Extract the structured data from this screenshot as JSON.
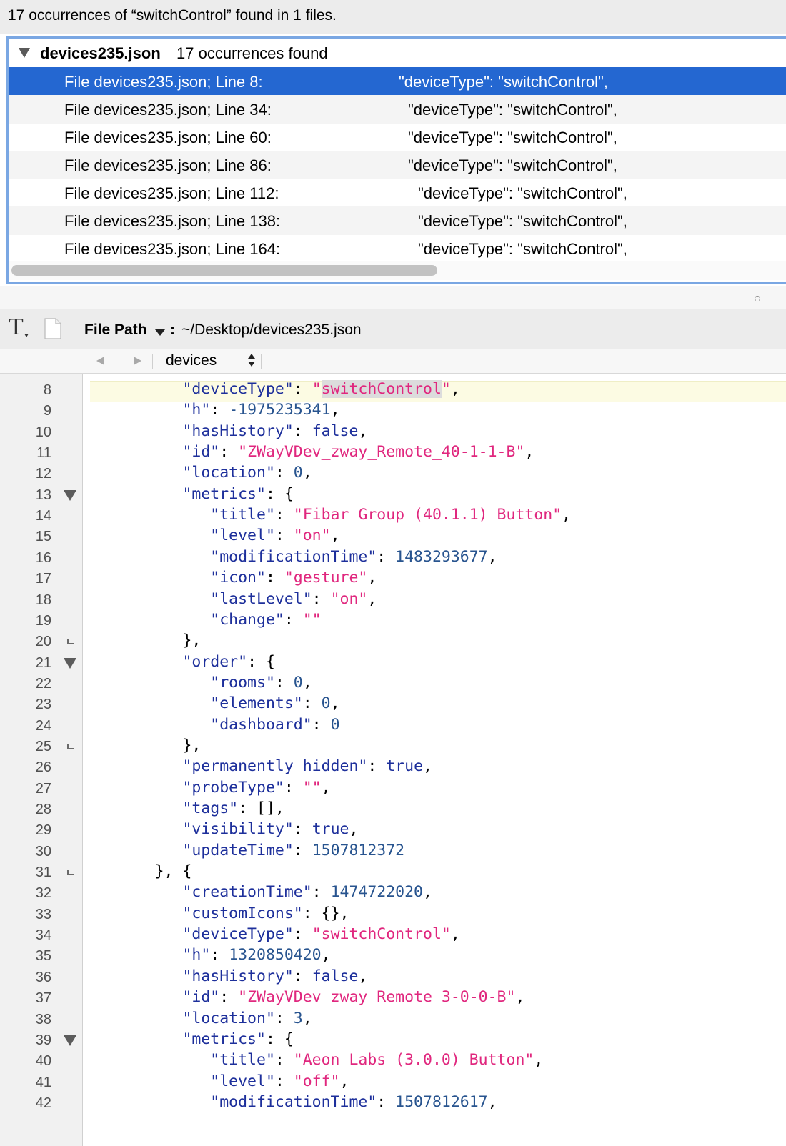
{
  "search": {
    "summary": "17 occurrences of “switchControl” found in 1 files."
  },
  "results": {
    "file": {
      "name": "devices235.json",
      "count": "17 occurrences found"
    },
    "rows": [
      {
        "location": "File devices235.json; Line 8:",
        "match": "\"deviceType\": \"switchControl\",",
        "selected": true
      },
      {
        "location": "File devices235.json; Line 34:",
        "match": "\"deviceType\": \"switchControl\",",
        "selected": false
      },
      {
        "location": "File devices235.json; Line 60:",
        "match": "\"deviceType\": \"switchControl\",",
        "selected": false
      },
      {
        "location": "File devices235.json; Line 86:",
        "match": "\"deviceType\": \"switchControl\",",
        "selected": false
      },
      {
        "location": "File devices235.json; Line 112:",
        "match": "\"deviceType\": \"switchControl\",",
        "selected": false
      },
      {
        "location": "File devices235.json; Line 138:",
        "match": "\"deviceType\": \"switchControl\",",
        "selected": false
      },
      {
        "location": "File devices235.json; Line 164:",
        "match": "\"deviceType\": \"switchControl\",",
        "selected": false
      }
    ]
  },
  "toolbar": {
    "text_icon": "T",
    "path_label": "File Path",
    "path_colon": ":",
    "path_value": "~/Desktop/devices235.json"
  },
  "navbar": {
    "symbol": "devices"
  },
  "editor": {
    "search_term": "switchControl",
    "current_line": 8,
    "lines": [
      {
        "n": 8,
        "fold": "none",
        "tokens": [
          [
            "ws",
            "          "
          ],
          [
            "key",
            "\"deviceType\""
          ],
          [
            "p",
            ": "
          ],
          [
            "str",
            "\"switchControl\"",
            "match"
          ],
          [
            "p",
            ","
          ]
        ]
      },
      {
        "n": 9,
        "fold": "none",
        "tokens": [
          [
            "ws",
            "          "
          ],
          [
            "key",
            "\"h\""
          ],
          [
            "p",
            ": "
          ],
          [
            "num",
            "-1975235341"
          ],
          [
            "p",
            ","
          ]
        ]
      },
      {
        "n": 10,
        "fold": "none",
        "tokens": [
          [
            "ws",
            "          "
          ],
          [
            "key",
            "\"hasHistory\""
          ],
          [
            "p",
            ": "
          ],
          [
            "kw",
            "false"
          ],
          [
            "p",
            ","
          ]
        ]
      },
      {
        "n": 11,
        "fold": "none",
        "tokens": [
          [
            "ws",
            "          "
          ],
          [
            "key",
            "\"id\""
          ],
          [
            "p",
            ": "
          ],
          [
            "str",
            "\"ZWayVDev_zway_Remote_40-1-1-B\""
          ],
          [
            "p",
            ","
          ]
        ]
      },
      {
        "n": 12,
        "fold": "none",
        "tokens": [
          [
            "ws",
            "          "
          ],
          [
            "key",
            "\"location\""
          ],
          [
            "p",
            ": "
          ],
          [
            "num",
            "0"
          ],
          [
            "p",
            ","
          ]
        ]
      },
      {
        "n": 13,
        "fold": "open",
        "tokens": [
          [
            "ws",
            "          "
          ],
          [
            "key",
            "\"metrics\""
          ],
          [
            "p",
            ": {"
          ]
        ]
      },
      {
        "n": 14,
        "fold": "none",
        "tokens": [
          [
            "ws",
            "             "
          ],
          [
            "key",
            "\"title\""
          ],
          [
            "p",
            ": "
          ],
          [
            "str",
            "\"Fibar Group (40.1.1) Button\""
          ],
          [
            "p",
            ","
          ]
        ]
      },
      {
        "n": 15,
        "fold": "none",
        "tokens": [
          [
            "ws",
            "             "
          ],
          [
            "key",
            "\"level\""
          ],
          [
            "p",
            ": "
          ],
          [
            "str",
            "\"on\""
          ],
          [
            "p",
            ","
          ]
        ]
      },
      {
        "n": 16,
        "fold": "none",
        "tokens": [
          [
            "ws",
            "             "
          ],
          [
            "key",
            "\"modificationTime\""
          ],
          [
            "p",
            ": "
          ],
          [
            "num",
            "1483293677"
          ],
          [
            "p",
            ","
          ]
        ]
      },
      {
        "n": 17,
        "fold": "none",
        "tokens": [
          [
            "ws",
            "             "
          ],
          [
            "key",
            "\"icon\""
          ],
          [
            "p",
            ": "
          ],
          [
            "str",
            "\"gesture\""
          ],
          [
            "p",
            ","
          ]
        ]
      },
      {
        "n": 18,
        "fold": "none",
        "tokens": [
          [
            "ws",
            "             "
          ],
          [
            "key",
            "\"lastLevel\""
          ],
          [
            "p",
            ": "
          ],
          [
            "str",
            "\"on\""
          ],
          [
            "p",
            ","
          ]
        ]
      },
      {
        "n": 19,
        "fold": "none",
        "tokens": [
          [
            "ws",
            "             "
          ],
          [
            "key",
            "\"change\""
          ],
          [
            "p",
            ": "
          ],
          [
            "str",
            "\"\""
          ]
        ]
      },
      {
        "n": 20,
        "fold": "end",
        "tokens": [
          [
            "ws",
            "          "
          ],
          [
            "p",
            "},"
          ]
        ]
      },
      {
        "n": 21,
        "fold": "open",
        "tokens": [
          [
            "ws",
            "          "
          ],
          [
            "key",
            "\"order\""
          ],
          [
            "p",
            ": {"
          ]
        ]
      },
      {
        "n": 22,
        "fold": "none",
        "tokens": [
          [
            "ws",
            "             "
          ],
          [
            "key",
            "\"rooms\""
          ],
          [
            "p",
            ": "
          ],
          [
            "num",
            "0"
          ],
          [
            "p",
            ","
          ]
        ]
      },
      {
        "n": 23,
        "fold": "none",
        "tokens": [
          [
            "ws",
            "             "
          ],
          [
            "key",
            "\"elements\""
          ],
          [
            "p",
            ": "
          ],
          [
            "num",
            "0"
          ],
          [
            "p",
            ","
          ]
        ]
      },
      {
        "n": 24,
        "fold": "none",
        "tokens": [
          [
            "ws",
            "             "
          ],
          [
            "key",
            "\"dashboard\""
          ],
          [
            "p",
            ": "
          ],
          [
            "num",
            "0"
          ]
        ]
      },
      {
        "n": 25,
        "fold": "end",
        "tokens": [
          [
            "ws",
            "          "
          ],
          [
            "p",
            "},"
          ]
        ]
      },
      {
        "n": 26,
        "fold": "none",
        "tokens": [
          [
            "ws",
            "          "
          ],
          [
            "key",
            "\"permanently_hidden\""
          ],
          [
            "p",
            ": "
          ],
          [
            "kw",
            "true"
          ],
          [
            "p",
            ","
          ]
        ]
      },
      {
        "n": 27,
        "fold": "none",
        "tokens": [
          [
            "ws",
            "          "
          ],
          [
            "key",
            "\"probeType\""
          ],
          [
            "p",
            ": "
          ],
          [
            "str",
            "\"\""
          ],
          [
            "p",
            ","
          ]
        ]
      },
      {
        "n": 28,
        "fold": "none",
        "tokens": [
          [
            "ws",
            "          "
          ],
          [
            "key",
            "\"tags\""
          ],
          [
            "p",
            ": [],"
          ]
        ]
      },
      {
        "n": 29,
        "fold": "none",
        "tokens": [
          [
            "ws",
            "          "
          ],
          [
            "key",
            "\"visibility\""
          ],
          [
            "p",
            ": "
          ],
          [
            "kw",
            "true"
          ],
          [
            "p",
            ","
          ]
        ]
      },
      {
        "n": 30,
        "fold": "none",
        "tokens": [
          [
            "ws",
            "          "
          ],
          [
            "key",
            "\"updateTime\""
          ],
          [
            "p",
            ": "
          ],
          [
            "num",
            "1507812372"
          ]
        ]
      },
      {
        "n": 31,
        "fold": "end",
        "tokens": [
          [
            "ws",
            "       "
          ],
          [
            "p",
            "}, {"
          ]
        ]
      },
      {
        "n": 32,
        "fold": "none",
        "tokens": [
          [
            "ws",
            "          "
          ],
          [
            "key",
            "\"creationTime\""
          ],
          [
            "p",
            ": "
          ],
          [
            "num",
            "1474722020"
          ],
          [
            "p",
            ","
          ]
        ]
      },
      {
        "n": 33,
        "fold": "none",
        "tokens": [
          [
            "ws",
            "          "
          ],
          [
            "key",
            "\"customIcons\""
          ],
          [
            "p",
            ": {},"
          ]
        ]
      },
      {
        "n": 34,
        "fold": "none",
        "tokens": [
          [
            "ws",
            "          "
          ],
          [
            "key",
            "\"deviceType\""
          ],
          [
            "p",
            ": "
          ],
          [
            "str",
            "\"switchControl\""
          ],
          [
            "p",
            ","
          ]
        ]
      },
      {
        "n": 35,
        "fold": "none",
        "tokens": [
          [
            "ws",
            "          "
          ],
          [
            "key",
            "\"h\""
          ],
          [
            "p",
            ": "
          ],
          [
            "num",
            "1320850420"
          ],
          [
            "p",
            ","
          ]
        ]
      },
      {
        "n": 36,
        "fold": "none",
        "tokens": [
          [
            "ws",
            "          "
          ],
          [
            "key",
            "\"hasHistory\""
          ],
          [
            "p",
            ": "
          ],
          [
            "kw",
            "false"
          ],
          [
            "p",
            ","
          ]
        ]
      },
      {
        "n": 37,
        "fold": "none",
        "tokens": [
          [
            "ws",
            "          "
          ],
          [
            "key",
            "\"id\""
          ],
          [
            "p",
            ": "
          ],
          [
            "str",
            "\"ZWayVDev_zway_Remote_3-0-0-B\""
          ],
          [
            "p",
            ","
          ]
        ]
      },
      {
        "n": 38,
        "fold": "none",
        "tokens": [
          [
            "ws",
            "          "
          ],
          [
            "key",
            "\"location\""
          ],
          [
            "p",
            ": "
          ],
          [
            "num",
            "3"
          ],
          [
            "p",
            ","
          ]
        ]
      },
      {
        "n": 39,
        "fold": "open",
        "tokens": [
          [
            "ws",
            "          "
          ],
          [
            "key",
            "\"metrics\""
          ],
          [
            "p",
            ": {"
          ]
        ]
      },
      {
        "n": 40,
        "fold": "none",
        "tokens": [
          [
            "ws",
            "             "
          ],
          [
            "key",
            "\"title\""
          ],
          [
            "p",
            ": "
          ],
          [
            "str",
            "\"Aeon Labs (3.0.0) Button\""
          ],
          [
            "p",
            ","
          ]
        ]
      },
      {
        "n": 41,
        "fold": "none",
        "tokens": [
          [
            "ws",
            "             "
          ],
          [
            "key",
            "\"level\""
          ],
          [
            "p",
            ": "
          ],
          [
            "str",
            "\"off\""
          ],
          [
            "p",
            ","
          ]
        ]
      },
      {
        "n": 42,
        "fold": "none",
        "tokens": [
          [
            "ws",
            "             "
          ],
          [
            "key",
            "\"modificationTime\""
          ],
          [
            "p",
            ": "
          ],
          [
            "num",
            "1507812617"
          ],
          [
            "p",
            ","
          ]
        ]
      }
    ]
  },
  "colors": {
    "selection": "#2467d1",
    "key": "#1d2f9b",
    "string": "#e0277e",
    "number": "#28548f",
    "current_line": "#fcfbe3"
  }
}
